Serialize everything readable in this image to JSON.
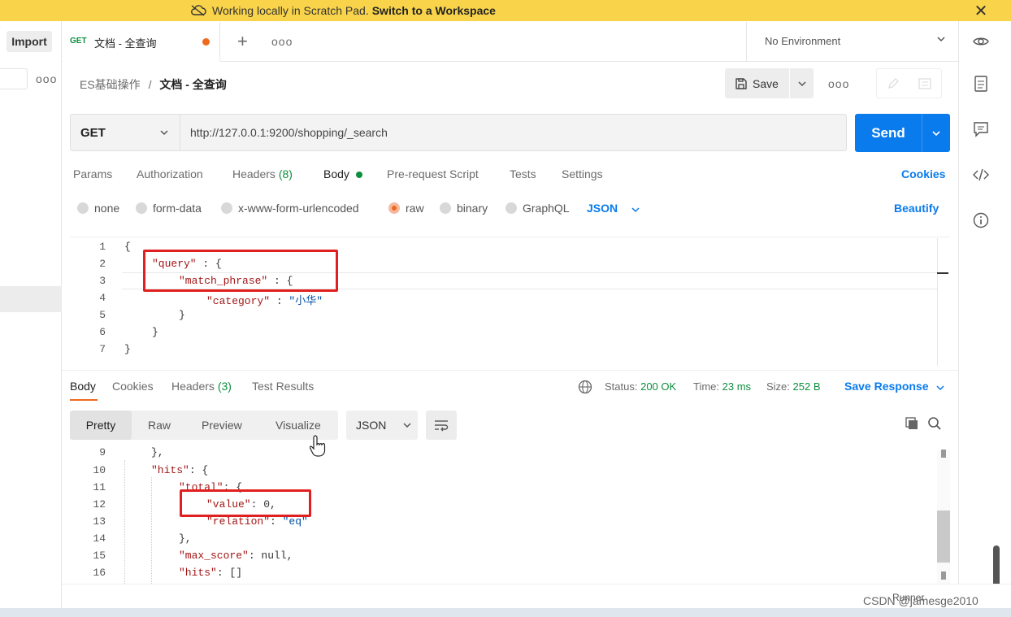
{
  "banner": {
    "message": "Working locally in Scratch Pad.",
    "cta": "Switch to a Workspace"
  },
  "sidebar": {
    "import_label": "Import"
  },
  "tab": {
    "method": "GET",
    "title": "文档 - 全查询"
  },
  "environment": {
    "label": "No Environment"
  },
  "breadcrumb": {
    "collection": "ES基础操作",
    "separator": "/",
    "request": "文档 - 全查询"
  },
  "toolbar": {
    "save_label": "Save"
  },
  "request": {
    "method": "GET",
    "url": "http://127.0.0.1:9200/shopping/_search",
    "send_label": "Send"
  },
  "request_tabs": {
    "params": "Params",
    "authorization": "Authorization",
    "headers": "Headers",
    "headers_count": "(8)",
    "body": "Body",
    "prerequest": "Pre-request Script",
    "tests": "Tests",
    "settings": "Settings",
    "cookies": "Cookies"
  },
  "body_types": {
    "none": "none",
    "form_data": "form-data",
    "urlencoded": "x-www-form-urlencoded",
    "raw": "raw",
    "binary": "binary",
    "graphql": "GraphQL",
    "format": "JSON",
    "beautify": "Beautify"
  },
  "request_body": {
    "line_numbers": [
      "1",
      "2",
      "3",
      "4",
      "5",
      "6",
      "7"
    ],
    "l1": "{",
    "l2_key": "\"query\"",
    "l2_rest": " : {",
    "l3_key": "\"match_phrase\"",
    "l3_rest": " : {",
    "l4_key": "\"category\"",
    "l4_sep": " : ",
    "l4_val": "\"小华\"",
    "l5": "}",
    "l6": "}",
    "l7": "}"
  },
  "response_tabs": {
    "body": "Body",
    "cookies": "Cookies",
    "headers": "Headers",
    "headers_count": "(3)",
    "test_results": "Test Results"
  },
  "response_meta": {
    "status_label": "Status:",
    "status_value": "200 OK",
    "time_label": "Time:",
    "time_value": "23 ms",
    "size_label": "Size:",
    "size_value": "252 B",
    "save_response": "Save Response"
  },
  "view_modes": {
    "pretty": "Pretty",
    "raw": "Raw",
    "preview": "Preview",
    "visualize": "Visualize",
    "format": "JSON"
  },
  "response_body": {
    "line_numbers": [
      "9",
      "10",
      "11",
      "12",
      "13",
      "14",
      "15",
      "16"
    ],
    "l9": "},",
    "l10_key": "\"hits\"",
    "l10_rest": ": {",
    "l11_key": "\"total\"",
    "l11_rest": ": {",
    "l12_key": "\"value\"",
    "l12_rest": ": 0,",
    "l13_key": "\"relation\"",
    "l13_sep": ": ",
    "l13_val": "\"eq\"",
    "l14": "},",
    "l15_key": "\"max_score\"",
    "l15_rest": ": null,",
    "l16_key": "\"hits\"",
    "l16_rest": ": []"
  },
  "status_bar": {
    "runner": "Runner"
  },
  "watermark": "CSDN @jamesge2010",
  "colors": {
    "banner": "#f9d44a",
    "accent_blue": "#097bed",
    "accent_orange": "#ef6a1b",
    "green": "#0c8f3e",
    "highlight_red": "#e02020"
  }
}
